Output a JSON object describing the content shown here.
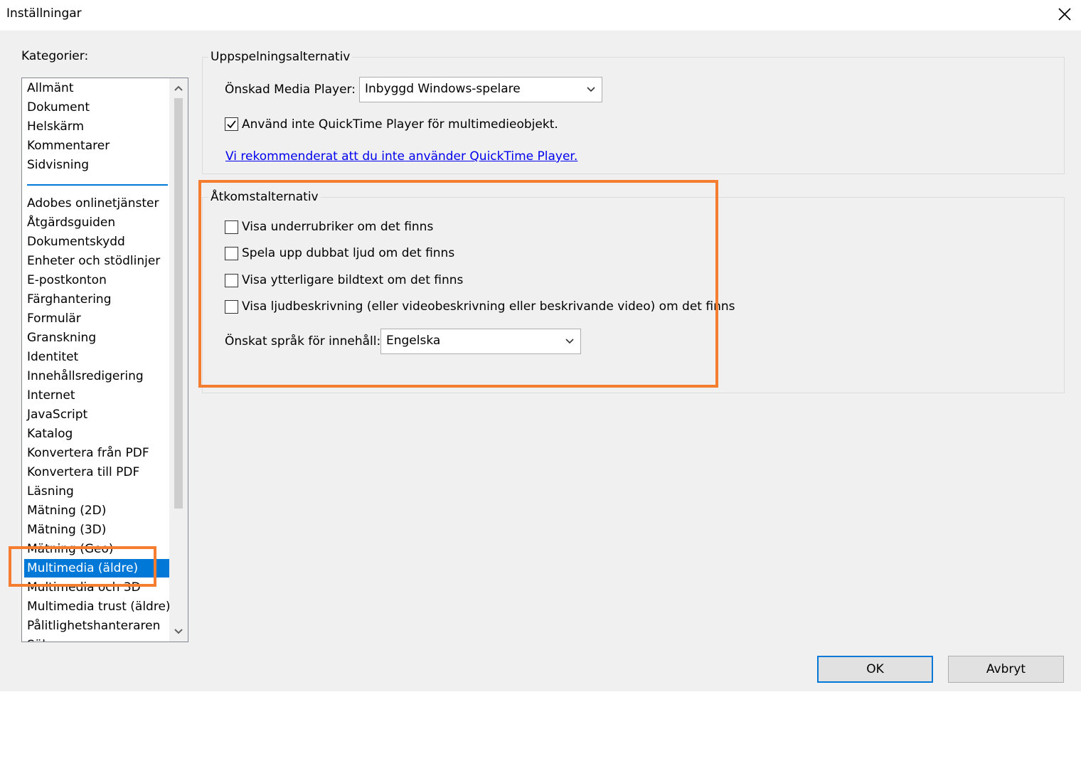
{
  "window": {
    "title": "Inställningar"
  },
  "categories": {
    "label": "Kategorier:",
    "group1": [
      "Allmänt",
      "Dokument",
      "Helskärm",
      "Kommentarer",
      "Sidvisning"
    ],
    "group2": [
      "Adobes onlinetjänster",
      "Åtgärdsguiden",
      "Dokumentskydd",
      "Enheter och stödlinjer",
      "E-postkonton",
      "Färghantering",
      "Formulär",
      "Granskning",
      "Identitet",
      "Innehållsredigering",
      "Internet",
      "JavaScript",
      "Katalog",
      "Konvertera från PDF",
      "Konvertera till PDF",
      "Läsning",
      "Mätning (2D)",
      "Mätning (3D)",
      "Mätning (Geo)",
      "Multimedia (äldre)",
      "Multimedia och 3D",
      "Multimedia trust (äldre)",
      "Pålitlighetshanteraren",
      "Sök"
    ],
    "selected": "Multimedia (äldre)"
  },
  "playback": {
    "title": "Uppspelningsalternativ",
    "player_label": "Önskad Media Player:",
    "player_value": "Inbyggd Windows-spelare",
    "no_quicktime_label": "Använd inte QuickTime Player för multimedieobjekt.",
    "no_quicktime_checked": true,
    "recommend_link": "Vi rekommenderat att du inte använder QuickTime Player."
  },
  "access": {
    "title": "Åtkomstalternativ",
    "options": [
      {
        "label": "Visa underrubriker om det finns",
        "checked": false
      },
      {
        "label": "Spela upp dubbat ljud om det finns",
        "checked": false
      },
      {
        "label": "Visa ytterligare bildtext om det finns",
        "checked": false
      },
      {
        "label": "Visa ljudbeskrivning (eller videobeskrivning eller beskrivande video) om det finns",
        "checked": false
      }
    ],
    "language_label": "Önskat språk för innehåll:",
    "language_value": "Engelska"
  },
  "buttons": {
    "ok": "OK",
    "cancel": "Avbryt"
  },
  "colors": {
    "selection": "#0078d7",
    "highlight": "#f47d30",
    "link": "#0000ee"
  }
}
